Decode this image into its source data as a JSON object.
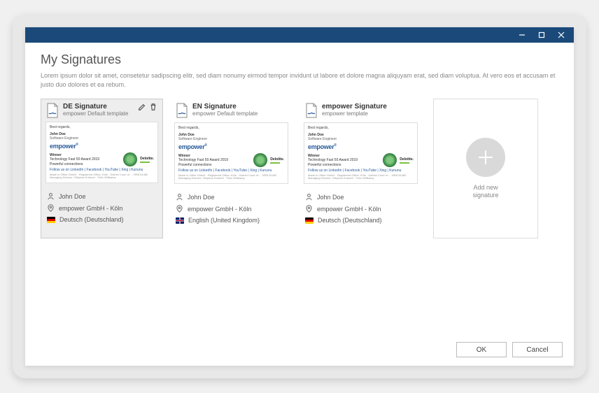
{
  "header": {
    "title": "My Signatures",
    "description": "Lorem ipsum dolor sit amet, consetetur sadipscing elitr, sed diam nonumy eirmod tempor invidunt ut labore et dolore magna aliquyam erat, sed diam voluptua. At vero eos et accusam et justo duo dolores et ea rebum."
  },
  "signatures": [
    {
      "name": "DE Signature",
      "template": "empower Default template",
      "selected": true,
      "preview": {
        "greeting": "Best regards,",
        "sender_name": "John Doe",
        "sender_role": "Software Engineer",
        "brand": "empower",
        "award_winner": "Winner",
        "award_text": "Technology Fast 50 Award 2019",
        "award_sub": "Powerful connections",
        "deloitte": "Deloitte.",
        "social": "Follow us on LinkedIn | Facebook | YouTube | Xing | Kununu",
        "legal": "Made in Office GmbH · Registered Office: Köln · District Court of ... HRB 81482 Managing Director: Stephan Kuhnert · Felix Wittkamp"
      },
      "user": "John Doe",
      "company": "empower GmbH - Köln",
      "language": "Deutsch (Deutschland)",
      "flag": "de"
    },
    {
      "name": "EN Signature",
      "template": "empower Default template",
      "selected": false,
      "preview": {
        "greeting": "Best regards,",
        "sender_name": "John Doe",
        "sender_role": "Software Engineer",
        "brand": "empower",
        "award_winner": "Winner",
        "award_text": "Technology Fast 50 Award 2019",
        "award_sub": "Powerful connections",
        "deloitte": "Deloitte.",
        "social": "Follow us on LinkedIn | Facebook | YouTube | Xing | Kununu",
        "legal": "Made in Office GmbH · Registered Office: Köln · District Court of ... HRB 81482 Managing Director: Stephan Kuhnert · Felix Wittkamp"
      },
      "user": "John Doe",
      "company": "empower GmbH - Köln",
      "language": "English (United Kingdom)",
      "flag": "uk"
    },
    {
      "name": "empower Signature",
      "template": "empower template",
      "selected": false,
      "preview": {
        "greeting": "Best regards,",
        "sender_name": "John Doe",
        "sender_role": "Software Engineer",
        "brand": "empower",
        "award_winner": "Winner",
        "award_text": "Technology Fast 50 Award 2019",
        "award_sub": "Powerful connections",
        "deloitte": "Deloitte.",
        "social": "Follow us on LinkedIn | Facebook | YouTube | Xing | Kununu",
        "legal": "Made in Office GmbH · Registered Office: Köln · District Court of ... HRB 81482 Managing Director: Stephan Kuhnert · Felix Wittkamp"
      },
      "user": "John Doe",
      "company": "empower GmbH - Köln",
      "language": "Deutsch (Deutschland)",
      "flag": "de"
    }
  ],
  "add_card": {
    "label": "Add new signature"
  },
  "footer": {
    "ok": "OK",
    "cancel": "Cancel"
  }
}
